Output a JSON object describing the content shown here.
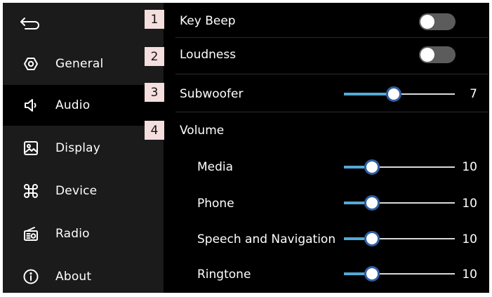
{
  "sidebar": {
    "items": [
      {
        "label": "General",
        "icon": "general-icon"
      },
      {
        "label": "Audio",
        "icon": "audio-icon",
        "active": true
      },
      {
        "label": "Display",
        "icon": "display-icon"
      },
      {
        "label": "Device",
        "icon": "device-icon"
      },
      {
        "label": "Radio",
        "icon": "radio-icon"
      },
      {
        "label": "About",
        "icon": "about-icon"
      }
    ]
  },
  "badges": [
    "1",
    "2",
    "3",
    "4"
  ],
  "settings": {
    "key_beep": {
      "label": "Key Beep",
      "on": false
    },
    "loudness": {
      "label": "Loudness",
      "on": false
    },
    "subwoofer": {
      "label": "Subwoofer",
      "value": "7",
      "level": 0.45
    },
    "volume": {
      "label": "Volume"
    },
    "media": {
      "label": "Media",
      "value": "10",
      "level": 0.25
    },
    "phone": {
      "label": "Phone",
      "value": "10",
      "level": 0.25
    },
    "speech": {
      "label": "Speech and Navigation",
      "value": "10",
      "level": 0.25
    },
    "ringtone": {
      "label": "Ringtone",
      "value": "10",
      "level": 0.25
    }
  },
  "colors": {
    "accent": "#54a9d6",
    "thumb_border": "#2f5fa0",
    "badge_bg": "#f4dede"
  }
}
